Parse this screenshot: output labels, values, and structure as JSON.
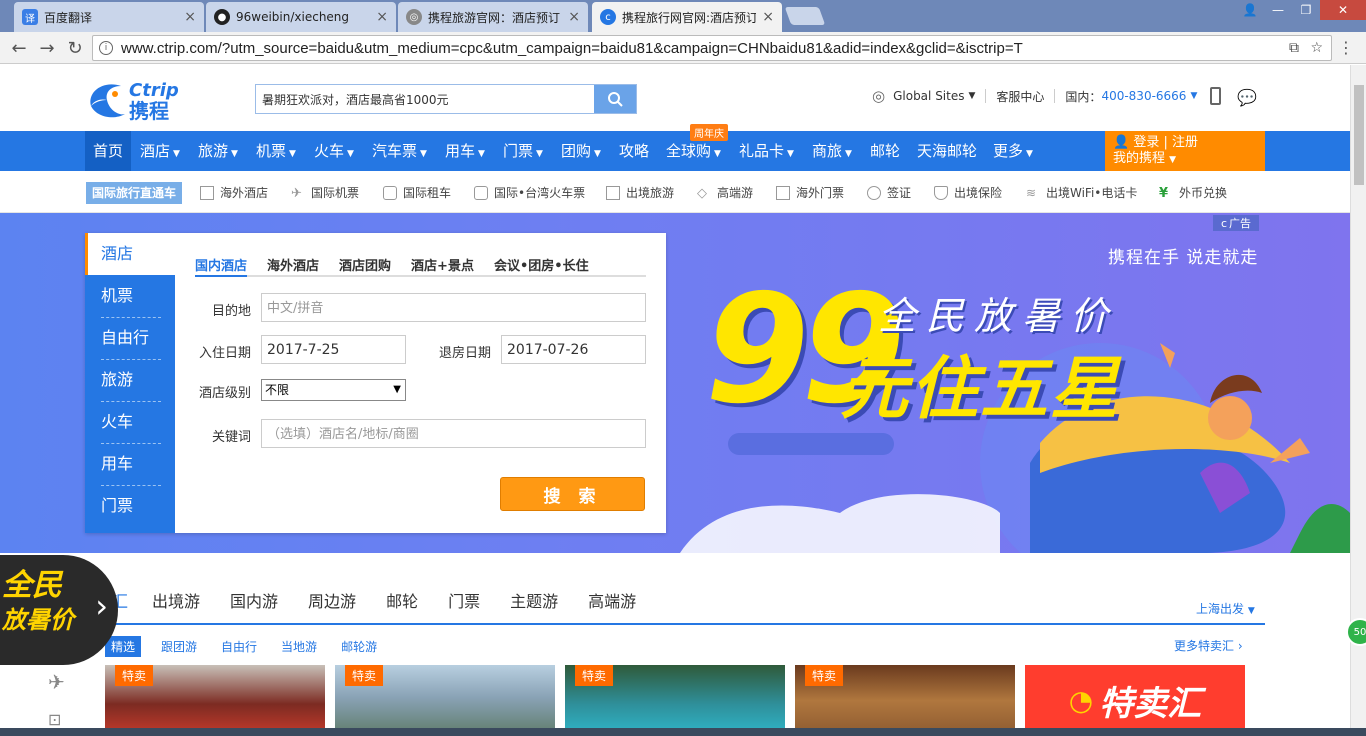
{
  "browser": {
    "tabs": [
      {
        "label": "百度翻译",
        "favicon": "translate-icon",
        "color": "#3a7ee6",
        "active": false
      },
      {
        "label": "96weibin/xiecheng",
        "favicon": "github-icon",
        "color": "#222222",
        "active": false
      },
      {
        "label": "携程旅游官网：酒店预订",
        "favicon": "globe-icon",
        "color": "#666666",
        "active": false
      },
      {
        "label": "携程旅行网官网:酒店预订",
        "favicon": "ctrip-icon",
        "color": "#2577e3",
        "active": true
      }
    ],
    "url": "www.ctrip.com/?utm_source=baidu&utm_medium=cpc&utm_campaign=baidu81&campaign=CHNbaidu81&adid=index&gclid=&isctrip=T"
  },
  "header": {
    "logo_text": "Ctrip",
    "logo_cn": "携程",
    "search_value": "暑期狂欢派对，酒店最高省1000元",
    "global_sites": "Global Sites",
    "service": "客服中心",
    "domestic_label": "国内：",
    "phone": "400-830-6666"
  },
  "nav": {
    "items": [
      {
        "label": "首页",
        "caret": false
      },
      {
        "label": "酒店",
        "caret": true
      },
      {
        "label": "旅游",
        "caret": true
      },
      {
        "label": "机票",
        "caret": true
      },
      {
        "label": "火车",
        "caret": true
      },
      {
        "label": "汽车票",
        "caret": true
      },
      {
        "label": "用车",
        "caret": true
      },
      {
        "label": "门票",
        "caret": true
      },
      {
        "label": "团购",
        "caret": true
      },
      {
        "label": "攻略",
        "caret": false
      },
      {
        "label": "全球购",
        "caret": true
      },
      {
        "label": "礼品卡",
        "caret": true
      },
      {
        "label": "商旅",
        "caret": true
      },
      {
        "label": "邮轮",
        "caret": false
      },
      {
        "label": "天海邮轮",
        "caret": false
      },
      {
        "label": "更多",
        "caret": true
      }
    ],
    "anniversary_badge": "周年庆",
    "login": "登录",
    "register": "注册",
    "my_ctrip": "我的携程"
  },
  "subnav": {
    "tag": "国际旅行直通车",
    "items": [
      {
        "label": "海外酒店",
        "icon": "hotel-icon"
      },
      {
        "label": "国际机票",
        "icon": "plane-icon"
      },
      {
        "label": "国际租车",
        "icon": "car-icon"
      },
      {
        "label": "国际•台湾火车票",
        "icon": "train-icon"
      },
      {
        "label": "出境旅游",
        "icon": "travel-icon"
      },
      {
        "label": "高端游",
        "icon": "diamond-icon"
      },
      {
        "label": "海外门票",
        "icon": "ticket-icon"
      },
      {
        "label": "签证",
        "icon": "globe-icon"
      },
      {
        "label": "出境保险",
        "icon": "shield-icon"
      },
      {
        "label": "出境WiFi•电话卡",
        "icon": "wifi-icon"
      },
      {
        "label": "外币兑换",
        "icon": "currency-icon"
      }
    ]
  },
  "banner": {
    "ad_label": "广告",
    "slogan": "携程在手 说走就走",
    "headline_num": "99",
    "headline_top": "全民放暑价",
    "headline_main": "元住五星"
  },
  "booking": {
    "side": [
      "酒店",
      "机票",
      "自由行",
      "旅游",
      "火车",
      "用车",
      "门票"
    ],
    "tabs": [
      "国内酒店",
      "海外酒店",
      "酒店团购",
      "酒店+景点",
      "会议•团房•长住"
    ],
    "destination_label": "目的地",
    "destination_placeholder": "中文/拼音",
    "checkin_label": "入住日期",
    "checkin_value": "2017-7-25",
    "checkout_label": "退房日期",
    "checkout_value": "2017-07-26",
    "level_label": "酒店级别",
    "level_value": "不限",
    "keyword_label": "关键词",
    "keyword_placeholder": "（选填）酒店名/地标/商圈",
    "search_button": "搜 索"
  },
  "promo": {
    "circle_line1": "全民",
    "circle_line2": "放暑价",
    "vacation_tabs": [
      "汇",
      "出境游",
      "国内游",
      "周边游",
      "邮轮",
      "门票",
      "主题游",
      "高端游"
    ],
    "departure": "上海出发",
    "subtabs": [
      "精选",
      "跟团游",
      "自由行",
      "当地游",
      "邮轮游"
    ],
    "more_deals": "更多特卖汇",
    "card_badge": "特卖",
    "teshui_label": "特卖汇"
  },
  "misc": {
    "green_badge": "50"
  }
}
